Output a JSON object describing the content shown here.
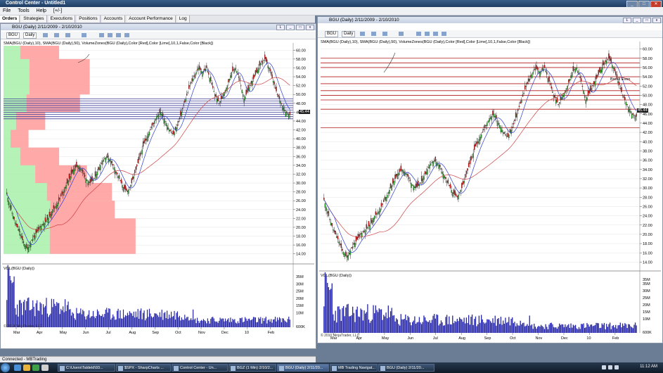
{
  "window_title": "Control Center - Untitled1",
  "menu": [
    "File",
    "Tools",
    "Help",
    "[+/-]"
  ],
  "tabs": [
    "Orders",
    "Strategies",
    "Executions",
    "Positions",
    "Accounts",
    "Account Performance",
    "Log"
  ],
  "left_panel": {
    "title": "BGU (Daily)  2/11/2009 - 2/10/2010",
    "symbol": "BGU",
    "interval": "Daily",
    "indicators": "SMA(BGU (Daily),10), SMA(BGU (Daily),50), VolumeZones(BGU (Daily),Color [Red],Color [Lime],10,1,False,Color [Black])",
    "last_price": "45.44",
    "volume_label": "VOL(BGU (Daily))",
    "copyright": "© 2010 NinjaTrader, LLC"
  },
  "right_panel": {
    "title": "BGU (Daily)  2/11/2009 - 2/10/2010",
    "symbol": "BGU",
    "interval": "Daily",
    "indicators": "SMA(BGU (Daily),10), SMA(BGU (Daily),50), VolumeZones(BGU (Daily),Color [Red],Color [Lime],10,1,False,Color [Black])",
    "last_price": "45.44",
    "break_even_label": "Break Even",
    "volume_label": "VOL(BGU (Daily))",
    "copyright": "© 2010 NinjaTrader, LLC"
  },
  "price_ticks": [
    "14.00",
    "16.00",
    "18.00",
    "20.00",
    "22.00",
    "24.00",
    "26.00",
    "28.00",
    "30.00",
    "32.00",
    "34.00",
    "36.00",
    "38.00",
    "40.00",
    "42.00",
    "44.00",
    "46.00",
    "48.00",
    "50.00",
    "52.00",
    "54.00",
    "56.00",
    "58.00",
    "60.00"
  ],
  "volume_ticks": [
    "600K",
    "10M",
    "15M",
    "20M",
    "25M",
    "30M",
    "35M"
  ],
  "volume_ticks_right": [
    "600K",
    "10M",
    "15M",
    "20M",
    "25M",
    "30M",
    "35M",
    "35M"
  ],
  "month_labels": [
    "Mar",
    "Apr",
    "May",
    "Jun",
    "Jul",
    "Aug",
    "Sep",
    "Oct",
    "Nov",
    "Dec",
    "10",
    "Feb"
  ],
  "status_text": "Connected - MBTrading",
  "taskbar": {
    "items": [
      "C:\\Users\\Taldeld\\93...",
      "$SPX - SharpCharts ...",
      "Control Center - Un...",
      "BGZ (1 Min)  2/10/2...",
      "BGU (Daily)  2/11/20...",
      "MB Trading Navigat...",
      "BGU (Daily)  2/11/20..."
    ],
    "clock": "11:12 AM"
  },
  "colors": {
    "up_candle": "#2aa12a",
    "down_candle": "#c41818",
    "sma10": "#2b3ccf",
    "sma50": "#d04040",
    "volume_bar": "#2424a8",
    "zone_red": "#ff9a9a",
    "zone_lime": "#a8f0a8",
    "level_line": "#b01818"
  },
  "chart_data": {
    "type": "candlestick",
    "title": "BGU (Daily)  2/11/2009 - 2/10/2010",
    "ylim": [
      13,
      61
    ],
    "volume_ylim": [
      0,
      38
    ],
    "weekly_close": [
      27.5,
      24,
      21,
      19,
      16.5,
      15,
      17,
      18.5,
      20,
      21,
      22,
      24,
      25,
      27,
      29,
      31,
      33,
      34,
      33,
      31,
      30,
      31,
      33,
      35,
      36,
      35,
      33,
      31,
      29,
      28,
      30,
      33,
      36,
      39,
      41,
      43,
      45,
      46,
      44,
      42,
      41,
      43,
      46,
      49,
      52,
      54,
      56,
      55,
      56,
      53,
      50,
      48,
      50,
      52,
      55,
      56,
      53,
      49,
      51,
      53,
      55,
      57,
      58,
      56,
      53,
      50,
      48,
      46,
      45.44
    ],
    "volume_zones": [
      {
        "low": 14,
        "high": 22,
        "up_share": 0.35,
        "total": 0.95
      },
      {
        "low": 22,
        "high": 26,
        "up_share": 0.42,
        "total": 0.8
      },
      {
        "low": 26,
        "high": 30,
        "up_share": 0.4,
        "total": 0.78
      },
      {
        "low": 30,
        "high": 34,
        "up_share": 0.38,
        "total": 0.6
      },
      {
        "low": 34,
        "high": 38,
        "up_share": 0.3,
        "total": 0.4
      },
      {
        "low": 38,
        "high": 42,
        "up_share": 0.28,
        "total": 0.18
      },
      {
        "low": 42,
        "high": 46,
        "up_share": 0.3,
        "total": 0.3
      },
      {
        "low": 46,
        "high": 50,
        "up_share": 0.3,
        "total": 0.55
      },
      {
        "low": 50,
        "high": 54,
        "up_share": 0.3,
        "total": 0.62
      },
      {
        "low": 54,
        "high": 58,
        "up_share": 0.3,
        "total": 0.62
      },
      {
        "low": 58,
        "high": 61,
        "up_share": 0.3,
        "total": 0.4
      }
    ],
    "left_level_lines": [
      44.5,
      45,
      45.5,
      46,
      46.5,
      47,
      47.5,
      48,
      48.5,
      49
    ],
    "right_level_lines": [
      43,
      47,
      49,
      50,
      51,
      52.5,
      54,
      56,
      57,
      58
    ]
  }
}
